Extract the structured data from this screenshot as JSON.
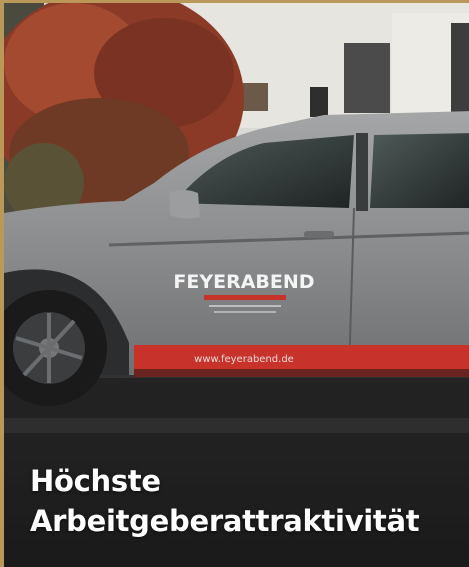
{
  "photo": {
    "brand_text": "FEYERABEND",
    "website_text": "www.feyerabend.de",
    "car_color": "#8d8f90",
    "stripe_color": "#c7322b",
    "frame_color": "#b9985a"
  },
  "caption": {
    "line1": "Höchste",
    "line2": "Arbeitgeberattraktivität"
  }
}
